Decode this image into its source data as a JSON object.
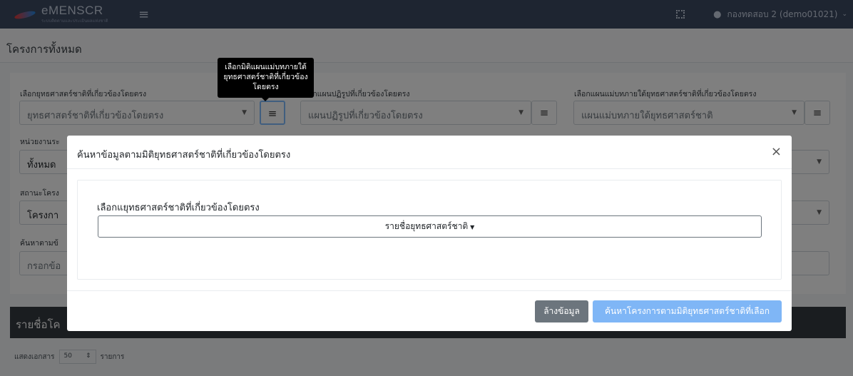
{
  "app": {
    "logo_text": "eMENSCR",
    "logo_sub": "ระบบติดตามและประเมินผลแห่งชาติ",
    "user": "กองทดสอบ 2 (demo01021)"
  },
  "page": {
    "title": "โครงการทั้งหมด"
  },
  "form": {
    "strategy_label": "เลือกยุทธศาสตร์ชาติที่เกี่ยวข้องโดยตรง",
    "strategy_placeholder": "ยุทธศาสตร์ชาติที่เกี่ยวข้องโดยตรง",
    "reform_label": "เลือกแผนปฏิรูปที่เกี่ยวข้องโดยตรง",
    "reform_placeholder": "แผนปฏิรูปที่เกี่ยวข้องโดยตรง",
    "master_label": "เลือกแผนแม่บทภายใต้ยุทธศาสตร์ชาติที่เกี่ยวข้องโดยตรง",
    "master_placeholder": "แผนแม่บทภายใต้ยุทธศาสตร์ชาติ",
    "agency_label": "หน่วยงานระ",
    "agency_value": "ทั้งหมด",
    "status_label": "สถานะโครง",
    "status_value": "โครงกา",
    "search_label": "ค้นหาตามข้",
    "search_placeholder": "กรอกข้อ"
  },
  "tooltip": {
    "text": "เลือกมิติแผนแม่บทภายใต้ยุทธศาสตร์ชาติที่เกี่ยวข้องโดยตรง"
  },
  "table": {
    "title": "รายชื่อโค",
    "show_label": "แสดงเอกสาร",
    "page_size": "50",
    "items_label": "รายการ"
  },
  "modal": {
    "title": "ค้นหาข้อมูลตามมิติยุทธศาสตร์ชาติที่เกี่ยวข้องโดยตรง",
    "close": "×",
    "select_label": "เลือกแยุทธศาสตร์ชาติที่เกี่ยวข้องโดยตรง",
    "dropdown_text": "รายชื่อยุทธศาสตร์ชาติ",
    "clear_button": "ล้างข้อมูล",
    "search_button": "ค้นหาโครงการตามมิติยุทธศาสตร์ชาติที่เลือก"
  },
  "icons": {
    "menu": "hamburger-icon",
    "expand": "fullscreen-icon",
    "user": "user-icon",
    "list": "list-icon"
  }
}
